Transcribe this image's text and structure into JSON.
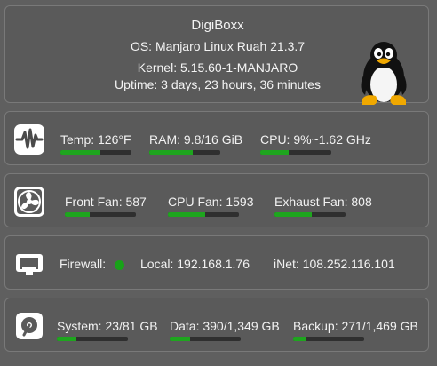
{
  "system": {
    "hostname": "DigiBoxx",
    "os_label": "OS:",
    "os_value": "Manjaro Linux Ruah  21.3.7",
    "kernel_label": "Kernel:",
    "kernel_value": "5.15.60-1-MANJARO",
    "uptime": "Uptime: 3 days, 23 hours, 36 minutes"
  },
  "sensors": {
    "temp": {
      "label": "Temp:  126°F",
      "level": 0.56
    },
    "ram": {
      "label": "RAM: 9.8/16 GiB",
      "level": 0.61
    },
    "cpu": {
      "label": "CPU: 9%~1.62 GHz",
      "level": 0.4
    }
  },
  "fans": {
    "front": {
      "label": "Front Fan: 587",
      "level": 0.35
    },
    "cpu": {
      "label": "CPU Fan: 1593",
      "level": 0.52
    },
    "exhaust": {
      "label": "Exhaust Fan: 808",
      "level": 0.52
    }
  },
  "network": {
    "firewall_label": "Firewall:",
    "firewall_status_color": "#18a218",
    "local": "Local:  192.168.1.76",
    "inet": "iNet:  108.252.116.101"
  },
  "storage": {
    "system": {
      "label": "System: 23/81 GB",
      "level": 0.28
    },
    "data": {
      "label": "Data: 390/1,349 GB",
      "level": 0.29
    },
    "backup": {
      "label": "Backup: 271/1,469 GB",
      "level": 0.18
    }
  },
  "icons": [
    "tux-penguin-icon",
    "activity-pulse-icon",
    "fan-icon",
    "network-monitor-icon",
    "hard-drive-icon"
  ],
  "colors": {
    "accent_bar": "#1ea51e",
    "panel": "#5a5a5a",
    "background": "#5f5f5f"
  }
}
